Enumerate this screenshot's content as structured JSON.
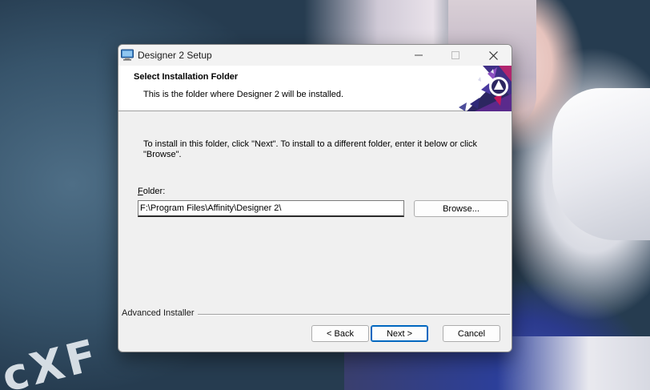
{
  "window": {
    "title": "Designer 2 Setup",
    "controls": {
      "minimize": "—",
      "maximize": "☐",
      "close": "✕"
    }
  },
  "header": {
    "title": "Select Installation Folder",
    "subtitle": "This is the folder where Designer 2 will be installed."
  },
  "content": {
    "instructions": "To install in this folder, click \"Next\". To install to a different folder, enter it below or click \"Browse\".",
    "folder_label_accel": "F",
    "folder_label_rest": "older:",
    "folder_value": "F:\\Program Files\\Affinity\\Designer 2\\",
    "browse_label": "Browse..."
  },
  "footer": {
    "brand": "Advanced Installer",
    "back_label": "< Back",
    "next_label": "Next >",
    "cancel_label": "Cancel"
  },
  "background": {
    "watermark": "cXF"
  },
  "colors": {
    "accent": "#0067c0",
    "brand_purple": "#6b2a8c",
    "brand_magenta": "#c2185b"
  }
}
